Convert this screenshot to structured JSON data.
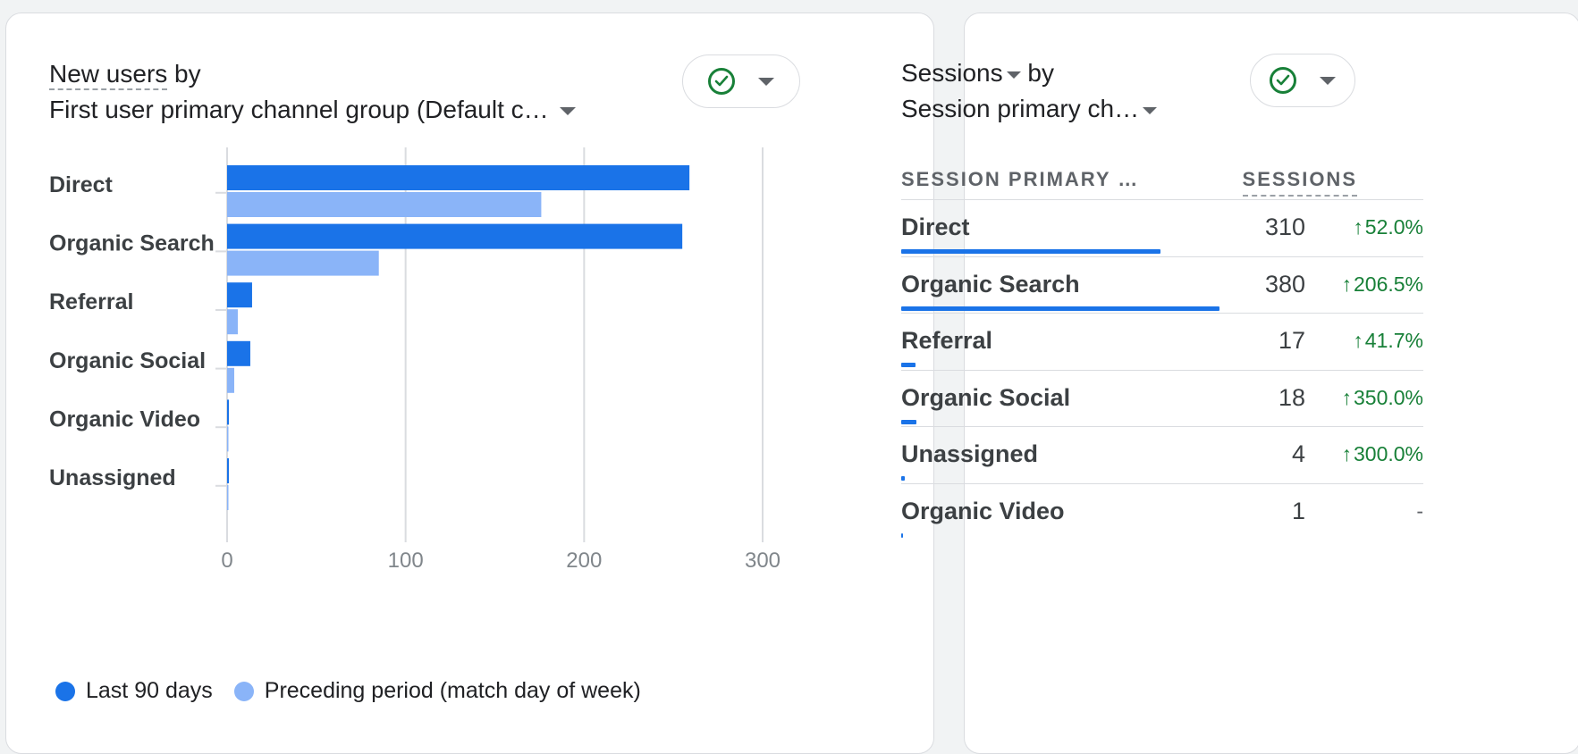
{
  "left_card": {
    "metric": "New users",
    "by_word": "by",
    "dimension": "First user primary channel group (Default c…",
    "status_icon": "check-circle-icon",
    "legend": [
      {
        "label": "Last 90 days",
        "color": "#1a73e8"
      },
      {
        "label": "Preceding period (match day of week)",
        "color": "#8ab4f8"
      }
    ]
  },
  "right_card": {
    "metric": "Sessions",
    "by_word": "by",
    "dimension": "Session primary ch…",
    "status_icon": "check-circle-icon",
    "col_dimension": "SESSION PRIMARY …",
    "col_metric": "SESSIONS",
    "rows": [
      {
        "label": "Direct",
        "value": "310",
        "change": "52.0%",
        "up": true
      },
      {
        "label": "Organic Search",
        "value": "380",
        "change": "206.5%",
        "up": true
      },
      {
        "label": "Referral",
        "value": "17",
        "change": "41.7%",
        "up": true
      },
      {
        "label": "Organic Social",
        "value": "18",
        "change": "350.0%",
        "up": true
      },
      {
        "label": "Unassigned",
        "value": "4",
        "change": "300.0%",
        "up": true
      },
      {
        "label": "Organic Video",
        "value": "1",
        "change": "-",
        "up": false
      }
    ]
  },
  "colors": {
    "primary": "#1a73e8",
    "secondary": "#8ab4f8",
    "positive": "#188038"
  },
  "chart_data": {
    "type": "bar",
    "orientation": "horizontal",
    "categories": [
      "Direct",
      "Organic Search",
      "Referral",
      "Organic Social",
      "Organic Video",
      "Unassigned"
    ],
    "series": [
      {
        "name": "Last 90 days",
        "values": [
          259,
          255,
          14,
          13,
          1,
          1
        ]
      },
      {
        "name": "Preceding period (match day of week)",
        "values": [
          176,
          85,
          6,
          4,
          0,
          0
        ]
      }
    ],
    "xlim": [
      0,
      300
    ],
    "xticks": [
      0,
      100,
      200,
      300
    ],
    "grid": true,
    "legend": "bottom-left"
  }
}
